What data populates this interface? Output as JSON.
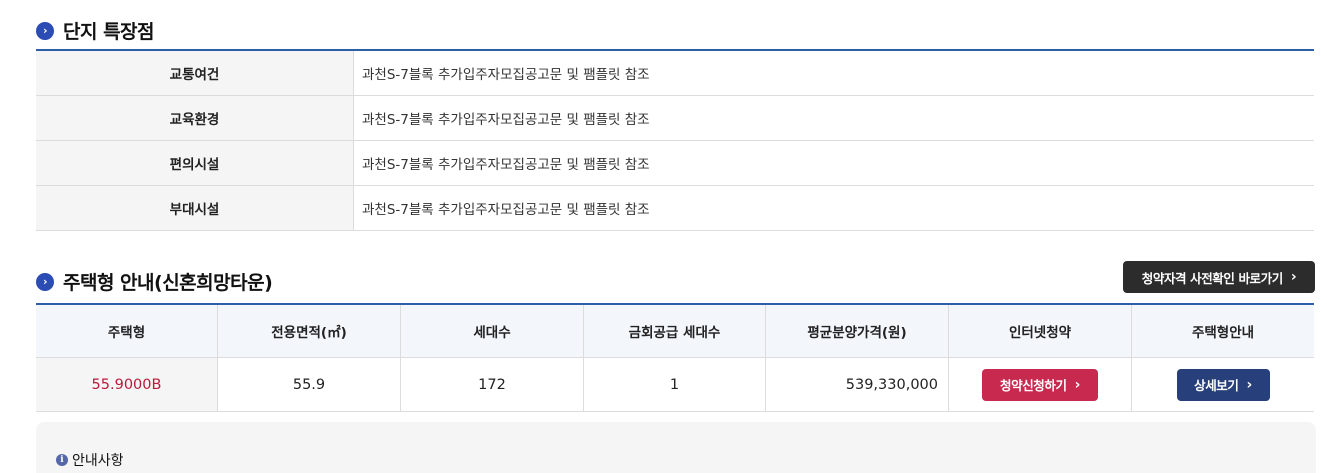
{
  "features_section": {
    "title": "단지 특장점",
    "rows": [
      {
        "label": "교통여건",
        "value": "과천S-7블록 추가입주자모집공고문 및 팸플릿 참조"
      },
      {
        "label": "교육환경",
        "value": "과천S-7블록 추가입주자모집공고문 및 팸플릿 참조"
      },
      {
        "label": "편의시설",
        "value": "과천S-7블록 추가입주자모집공고문 및 팸플릿 참조"
      },
      {
        "label": "부대시설",
        "value": "과천S-7블록 추가입주자모집공고문 및 팸플릿 참조"
      }
    ]
  },
  "housing_section": {
    "title": "주택형 안내(신혼희망타운)",
    "precheck_button": "청약자격 사전확인 바로가기",
    "headers": [
      "주택형",
      "전용면적(㎡)",
      "세대수",
      "금회공급 세대수",
      "평균분양가격(원)",
      "인터넷청약",
      "주택형안내"
    ],
    "rows": [
      {
        "type": "55.9000B",
        "area": "55.9",
        "households": "172",
        "supply": "1",
        "price": "539,330,000",
        "apply_button": "청약신청하기",
        "detail_button": "상세보기"
      }
    ]
  },
  "notice": {
    "title": "안내사항"
  },
  "colors": {
    "accent_blue": "#2c5fa8",
    "bullet_blue": "#2b4bb5",
    "apply_red": "#c8294f",
    "detail_navy": "#273f7a",
    "type_red": "#b71c3c"
  },
  "icons": {
    "section_bullet": "chevron-right-circle-icon",
    "button_chevron": "chevron-right-icon",
    "notice_icon": "info-icon"
  }
}
